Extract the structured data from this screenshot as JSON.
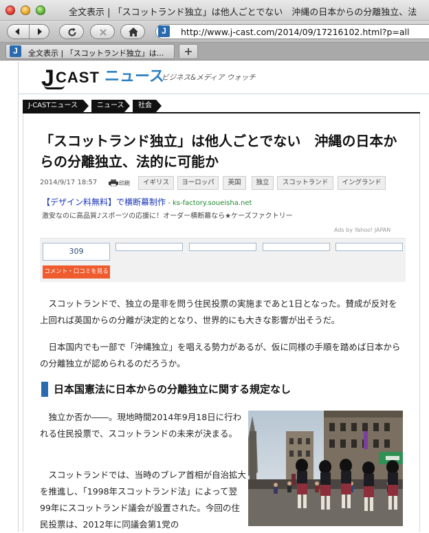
{
  "window": {
    "title": "全文表示 | 「スコットランド独立」は他人ごとでない　沖縄の日本からの分離独立、法"
  },
  "toolbar": {
    "url": "http://www.j-cast.com/2014/09/17216102.html?p=all",
    "favicon_letter": "J"
  },
  "tabs": [
    {
      "title": "全文表示 | 「スコットランド独立」は..."
    }
  ],
  "site": {
    "logo_j": "J",
    "logo_cast": "CAST",
    "logo_news": "ニュース",
    "tagline": "ビジネス&メディア ウォッチ"
  },
  "breadcrumbs": [
    "J-CASTニュース",
    "ニュース",
    "社会"
  ],
  "article": {
    "headline": "「スコットランド独立」は他人ごとでない　沖縄の日本からの分離独立、法的に可能か",
    "date": "2014/9/17 18:57",
    "print_label": "印刷",
    "tags": [
      "イギリス",
      "ヨーロッパ",
      "英国",
      "独立",
      "スコットランド",
      "イングランド"
    ],
    "paragraphs": [
      "スコットランドで、独立の是非を問う住民投票の実施まであと1日となった。賛成が反対を上回れば英国からの分離が決定的となり、世界的にも大きな影響が出そうだ。",
      "日本国内でも一部で「沖縄独立」を唱える勢力があるが、仮に同様の手順を踏めば日本からの分離独立が認められるのだろうか。"
    ],
    "section_heading": "日本国憲法に日本からの分離独立に関する規定なし",
    "section_paragraphs": [
      "独立か否か――。現地時間2014年9月18日に行われる住民投票で、スコットランドの未来が決まる。",
      "スコットランドでは、当時のブレア首相が自治拡大を推進し、「1998年スコットランド法」によって翌99年にスコットランド議会が設置された。今回の住民投票は、2012年に同議会第1党の"
    ]
  },
  "ad": {
    "title": "【デザイン料無料】で横断幕制作",
    "domain": " - ks-factory.soueisha.net",
    "description": "激安なのに高品質♪スポーツの応援に！オーダー横断幕なら★ケーズファクトリー",
    "credit": "Ads by Yahoo! JAPAN"
  },
  "share": {
    "count": "309",
    "comment_button": "コメント・口コミを見る"
  },
  "colors": {
    "accent": "#2a6bb0",
    "comment_button": "#ee5b2c",
    "ad_link": "#1a35b8",
    "ad_domain": "#1f8a2e"
  }
}
